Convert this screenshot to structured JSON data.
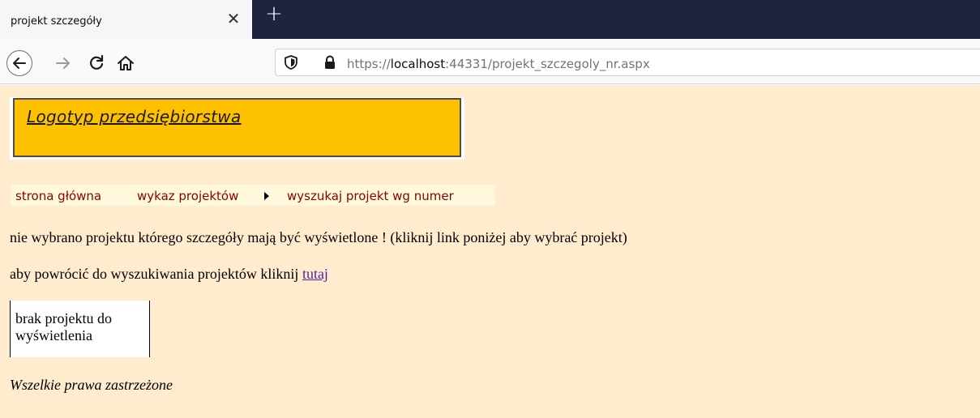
{
  "browser": {
    "tab_title": "projekt szczegóły",
    "tab_close_symbol": "✕",
    "new_tab_symbol": "+",
    "url_prefix": "https://",
    "url_host": "localhost",
    "url_rest": ":44331/projekt_szczegoly_nr.aspx"
  },
  "page": {
    "logo_text": "Logotyp przedsiębiorstwa",
    "menu": {
      "home": "strona główna",
      "projects_list": "wykaz projektów",
      "search_by_number": "wyszukaj projekt wg numer"
    },
    "message_no_project": "nie wybrano projektu którego szczegóły mają być wyświetlone ! (kliknij link poniżej aby wybrać projekt)",
    "message_return_prefix": "aby powrócić do wyszukiwania projektów kliknij",
    "message_return_link": "tutaj",
    "empty_box_text": "brak projektu do wyświetlenia",
    "footer": "Wszelkie prawa zastrzeżone"
  },
  "colors": {
    "tabstrip": "#202340",
    "page_background": "#ffebcd",
    "logo_background": "#fdc100",
    "menu_background": "#fff8dc",
    "menu_text": "#8b0000",
    "link": "#4b1f9e"
  },
  "icons": [
    "back-arrow-icon",
    "forward-arrow-icon",
    "reload-icon",
    "home-icon",
    "tracking-shield-icon",
    "lock-icon"
  ]
}
